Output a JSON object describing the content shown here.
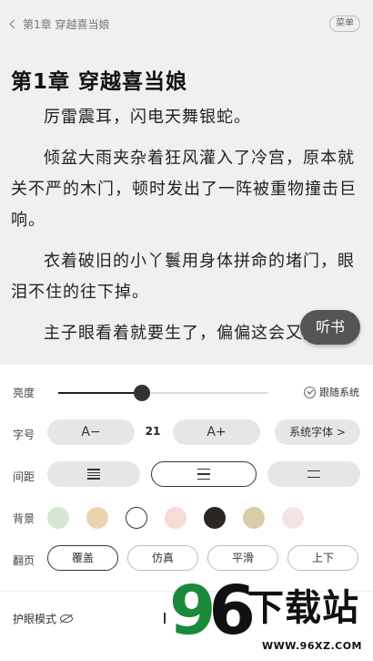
{
  "header": {
    "back_label": "第1章 穿越喜当娘",
    "menu_label": "菜单"
  },
  "chapter": {
    "title": "第1章  穿越喜当娘",
    "paragraphs": [
      "厉雷震耳，闪电天舞银蛇。",
      "倾盆大雨夹杂着狂风灌入了冷宫，原本就关不严的木门，顿时发出了一阵被重物撞击巨响。",
      "衣着破旧的小丫鬟用身体拼命的堵门，眼泪不住的往下掉。",
      "主子眼看着就要生了，偏偏这会又遇到"
    ]
  },
  "listen_button": "听书",
  "settings": {
    "brightness": {
      "label": "亮度",
      "level": 0.4,
      "follow_system_label": "跟随系统"
    },
    "font_size": {
      "label": "字号",
      "decrease_label": "A−",
      "value": "21",
      "increase_label": "A+",
      "font_button_label": "系统字体 >"
    },
    "spacing": {
      "label": "间距",
      "options": [
        "compact",
        "medium",
        "loose"
      ],
      "selected": "medium"
    },
    "background": {
      "label": "背景",
      "colors": [
        "#d4e7cf",
        "#e8d5b0",
        "#ffffff",
        "#f7dbd6",
        "#2a2623",
        "#d9ccaa",
        "#f6e4e4"
      ],
      "selected_index": 2
    },
    "page_turn": {
      "label": "翻页",
      "options": [
        "覆盖",
        "仿真",
        "平滑",
        "上下"
      ],
      "selected": "覆盖"
    },
    "eye_mode_label": "护眼模式"
  },
  "watermark": {
    "digit_1": "9",
    "digit_2": "6",
    "name": "下载站",
    "url": "WWW.96XZ.COM"
  }
}
